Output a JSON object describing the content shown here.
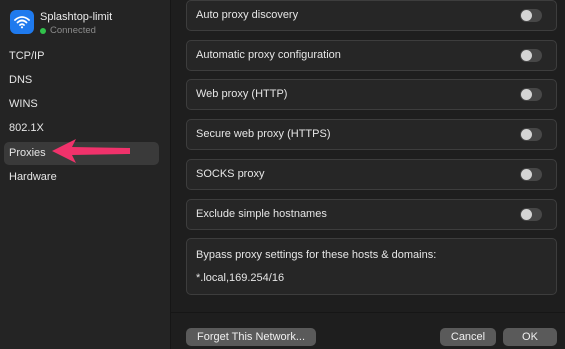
{
  "network": {
    "name": "Splashtop-limit",
    "status": "Connected",
    "status_color": "#31c24b",
    "icon": "wifi-icon",
    "icon_bg": "#1f7aee"
  },
  "sidebar": {
    "items": [
      {
        "label": "TCP/IP"
      },
      {
        "label": "DNS"
      },
      {
        "label": "WINS"
      },
      {
        "label": "802.1X"
      },
      {
        "label": "Proxies",
        "selected": true
      },
      {
        "label": "Hardware"
      }
    ]
  },
  "annotation": {
    "arrow_color": "#f0326b"
  },
  "proxies": {
    "options": [
      {
        "label": "Auto proxy discovery",
        "enabled": false
      },
      {
        "label": "Automatic proxy configuration",
        "enabled": false
      },
      {
        "label": "Web proxy (HTTP)",
        "enabled": false
      },
      {
        "label": "Secure web proxy (HTTPS)",
        "enabled": false
      },
      {
        "label": "SOCKS proxy",
        "enabled": false
      },
      {
        "label": "Exclude simple hostnames",
        "enabled": false
      }
    ],
    "bypass_label": "Bypass proxy settings for these hosts & domains:",
    "bypass_value": "*.local,169.254/16"
  },
  "footer": {
    "forget_label": "Forget This Network...",
    "cancel_label": "Cancel",
    "ok_label": "OK"
  }
}
